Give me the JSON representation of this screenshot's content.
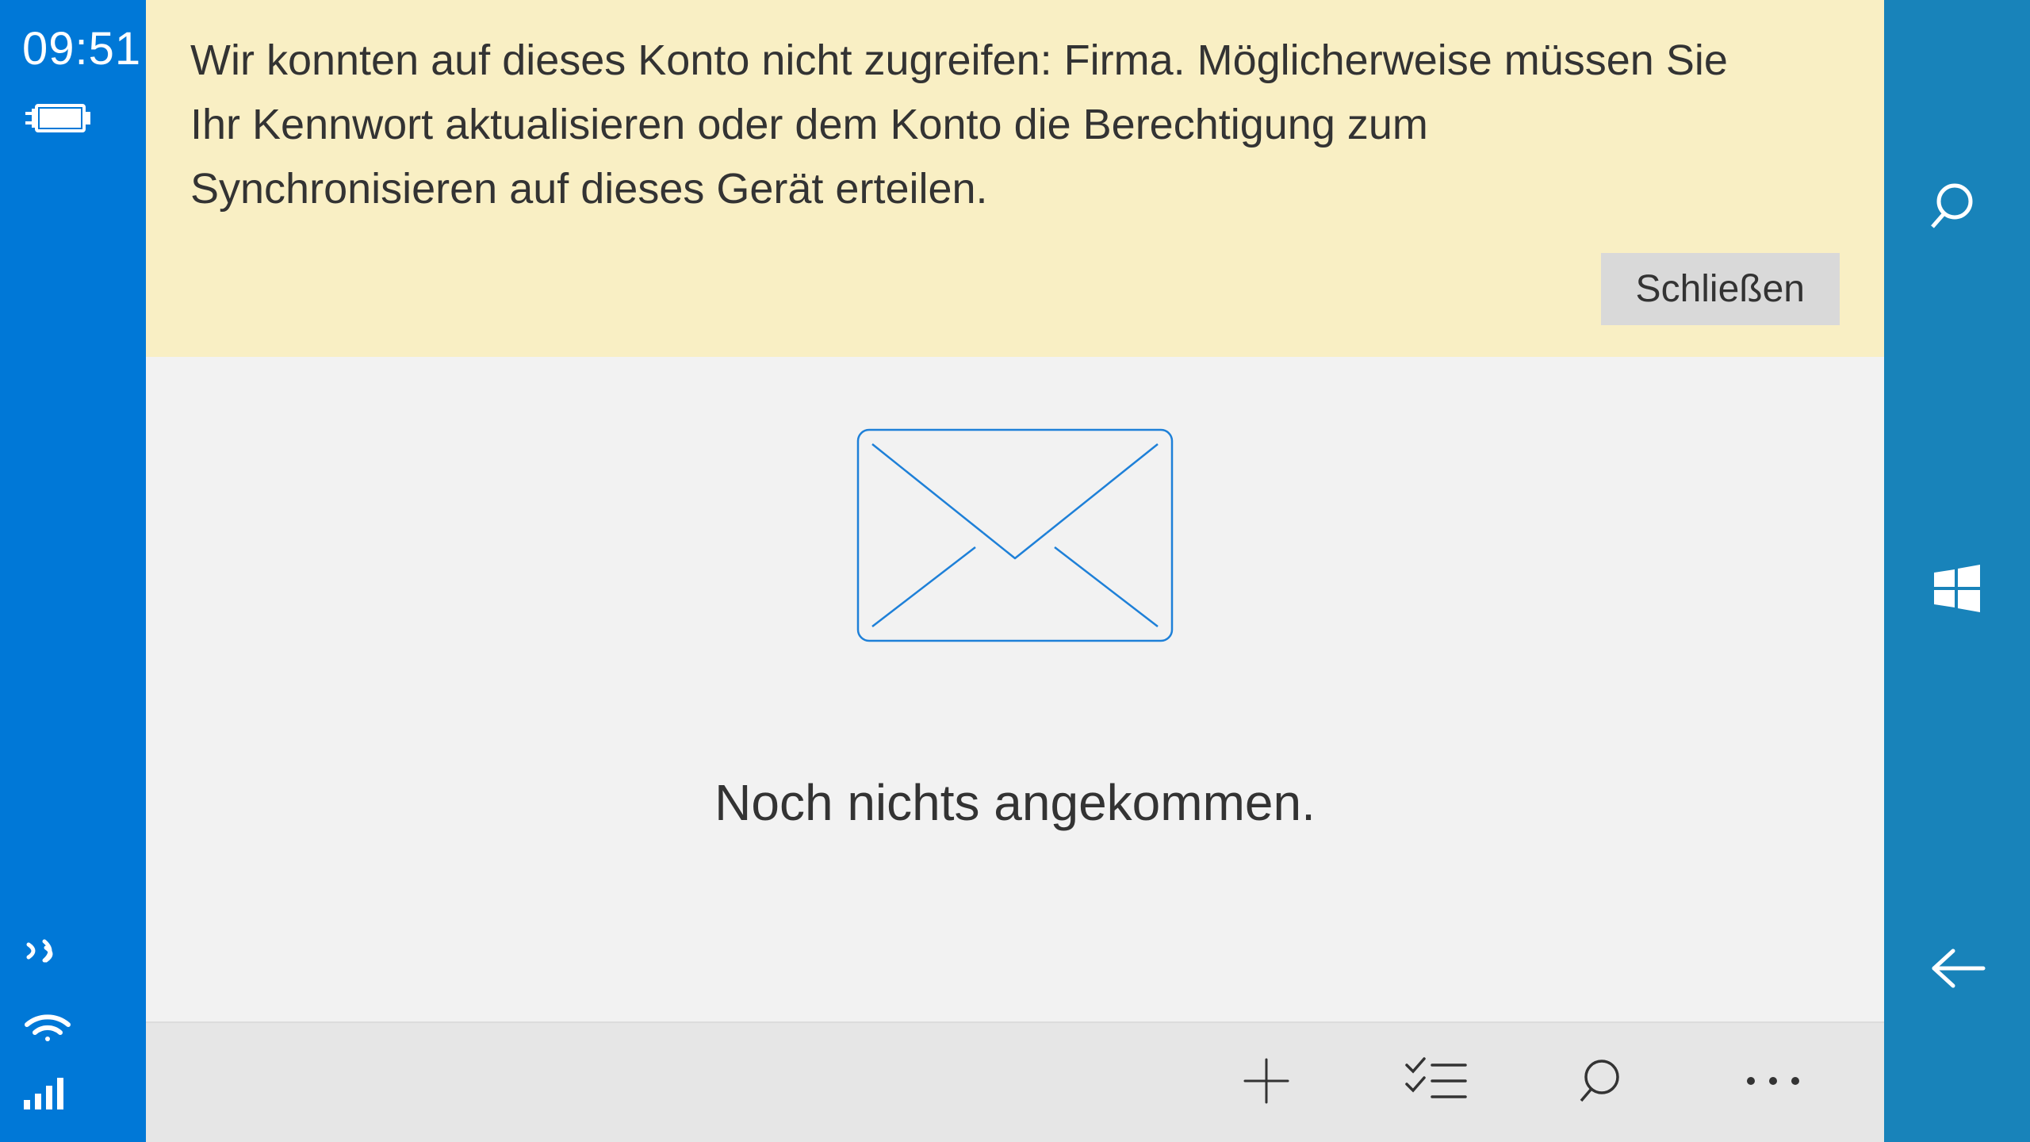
{
  "status": {
    "time": "09:51"
  },
  "banner": {
    "message": "Wir konnten auf dieses Konto nicht zugreifen: Firma. Möglicherweise müssen Sie Ihr Kennwort aktualisieren oder dem Konto die Berechtigung zum Synchronisieren auf dieses Gerät erteilen.",
    "close_label": "Schließen"
  },
  "main": {
    "empty_label": "Noch nichts angekommen."
  },
  "colors": {
    "accent": "#0078d7",
    "accent_dark": "#1883ba",
    "banner_bg": "#f9efc4",
    "envelope_stroke": "#1e80d8"
  }
}
